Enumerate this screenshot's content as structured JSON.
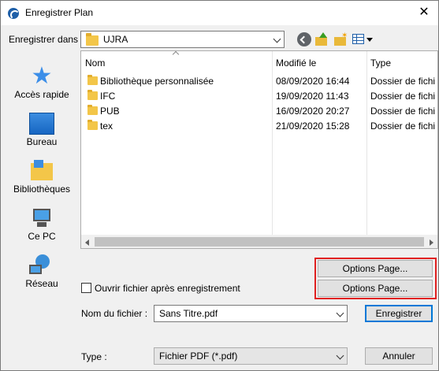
{
  "window": {
    "title": "Enregistrer Plan",
    "close_glyph": "✕"
  },
  "lookin": {
    "label": "Enregistrer dans :",
    "value": "UJRA"
  },
  "toolbar": {
    "back_icon": "back-arrow-icon",
    "up_icon": "folder-up-icon",
    "new_folder_icon": "new-folder-icon",
    "view_icon": "view-menu-icon"
  },
  "places": [
    {
      "label": "Accès rapide",
      "icon": "star-icon"
    },
    {
      "label": "Bureau",
      "icon": "desktop-icon"
    },
    {
      "label": "Bibliothèques",
      "icon": "libraries-icon"
    },
    {
      "label": "Ce PC",
      "icon": "computer-icon"
    },
    {
      "label": "Réseau",
      "icon": "network-icon"
    }
  ],
  "filelist": {
    "columns": [
      "Nom",
      "Modifié le",
      "Type"
    ],
    "rows": [
      {
        "name": "Bibliothèque personnalisée",
        "date": "08/09/2020 16:44",
        "type": "Dossier de fichi"
      },
      {
        "name": "IFC",
        "date": "19/09/2020 11:43",
        "type": "Dossier de fichi"
      },
      {
        "name": "PUB",
        "date": "16/09/2020 20:27",
        "type": "Dossier de fichi"
      },
      {
        "name": "tex",
        "date": "21/09/2020 15:28",
        "type": "Dossier de fichi"
      }
    ]
  },
  "options": {
    "btn1": "Options Page...",
    "btn2": "Options Page..."
  },
  "open_after": {
    "label": "Ouvrir fichier après enregistrement",
    "checked": false
  },
  "filename": {
    "label": "Nom du fichier :",
    "value": "Sans Titre.pdf"
  },
  "filetype": {
    "label": "Type :",
    "value": "Fichier PDF (*.pdf)"
  },
  "buttons": {
    "save": "Enregistrer",
    "cancel": "Annuler"
  },
  "colors": {
    "highlight": "#e02020",
    "accent": "#0078d7"
  }
}
